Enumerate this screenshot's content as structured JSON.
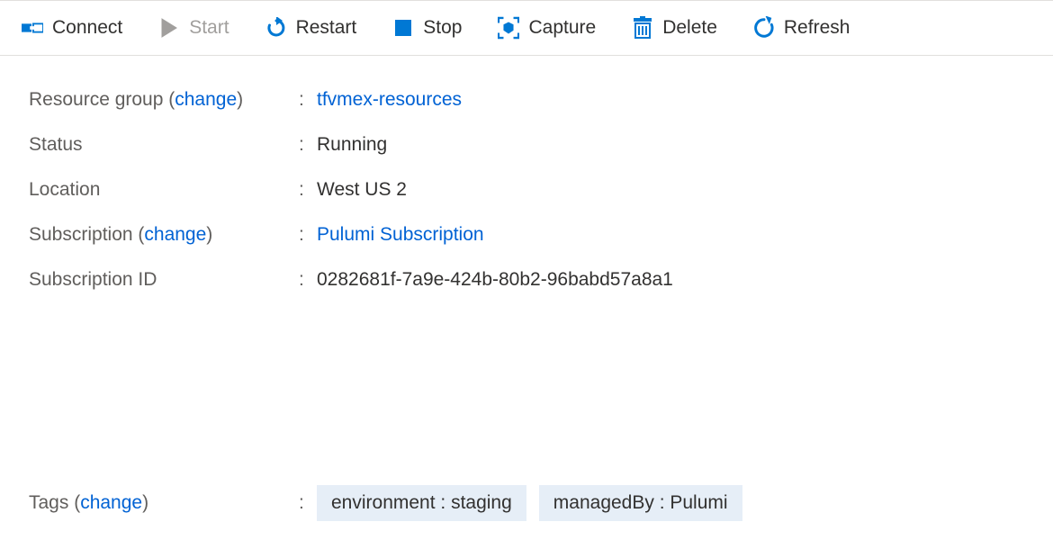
{
  "toolbar": {
    "connect": "Connect",
    "start": "Start",
    "restart": "Restart",
    "stop": "Stop",
    "capture": "Capture",
    "delete": "Delete",
    "refresh": "Refresh"
  },
  "labels": {
    "resource_group": "Resource group",
    "status": "Status",
    "location": "Location",
    "subscription": "Subscription",
    "subscription_id": "Subscription ID",
    "tags": "Tags",
    "change": "change"
  },
  "values": {
    "resource_group": "tfvmex-resources",
    "status": "Running",
    "location": "West US 2",
    "subscription": "Pulumi Subscription",
    "subscription_id": "0282681f-7a9e-424b-80b2-96babd57a8a1"
  },
  "tags": [
    {
      "key": "environment",
      "value": "staging"
    },
    {
      "key": "managedBy",
      "value": "Pulumi"
    }
  ],
  "colors": {
    "accent": "#0078d4",
    "link": "#0062d4",
    "disabled": "#a19f9d"
  }
}
